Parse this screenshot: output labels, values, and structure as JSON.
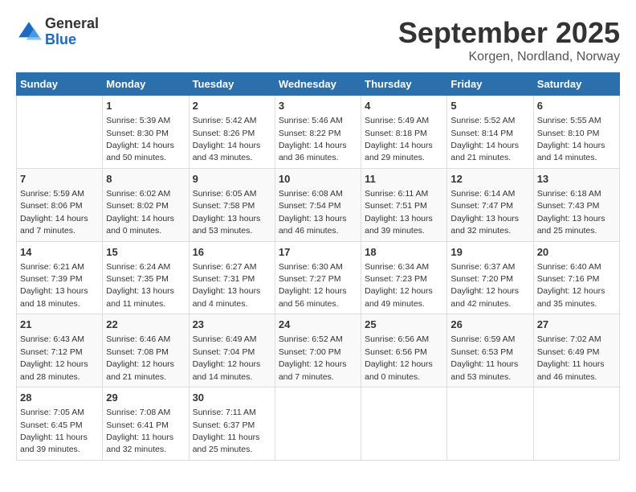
{
  "logo": {
    "general": "General",
    "blue": "Blue"
  },
  "title": "September 2025",
  "location": "Korgen, Nordland, Norway",
  "days_of_week": [
    "Sunday",
    "Monday",
    "Tuesday",
    "Wednesday",
    "Thursday",
    "Friday",
    "Saturday"
  ],
  "weeks": [
    [
      {
        "day": "",
        "info": ""
      },
      {
        "day": "1",
        "info": "Sunrise: 5:39 AM\nSunset: 8:30 PM\nDaylight: 14 hours\nand 50 minutes."
      },
      {
        "day": "2",
        "info": "Sunrise: 5:42 AM\nSunset: 8:26 PM\nDaylight: 14 hours\nand 43 minutes."
      },
      {
        "day": "3",
        "info": "Sunrise: 5:46 AM\nSunset: 8:22 PM\nDaylight: 14 hours\nand 36 minutes."
      },
      {
        "day": "4",
        "info": "Sunrise: 5:49 AM\nSunset: 8:18 PM\nDaylight: 14 hours\nand 29 minutes."
      },
      {
        "day": "5",
        "info": "Sunrise: 5:52 AM\nSunset: 8:14 PM\nDaylight: 14 hours\nand 21 minutes."
      },
      {
        "day": "6",
        "info": "Sunrise: 5:55 AM\nSunset: 8:10 PM\nDaylight: 14 hours\nand 14 minutes."
      }
    ],
    [
      {
        "day": "7",
        "info": "Sunrise: 5:59 AM\nSunset: 8:06 PM\nDaylight: 14 hours\nand 7 minutes."
      },
      {
        "day": "8",
        "info": "Sunrise: 6:02 AM\nSunset: 8:02 PM\nDaylight: 14 hours\nand 0 minutes."
      },
      {
        "day": "9",
        "info": "Sunrise: 6:05 AM\nSunset: 7:58 PM\nDaylight: 13 hours\nand 53 minutes."
      },
      {
        "day": "10",
        "info": "Sunrise: 6:08 AM\nSunset: 7:54 PM\nDaylight: 13 hours\nand 46 minutes."
      },
      {
        "day": "11",
        "info": "Sunrise: 6:11 AM\nSunset: 7:51 PM\nDaylight: 13 hours\nand 39 minutes."
      },
      {
        "day": "12",
        "info": "Sunrise: 6:14 AM\nSunset: 7:47 PM\nDaylight: 13 hours\nand 32 minutes."
      },
      {
        "day": "13",
        "info": "Sunrise: 6:18 AM\nSunset: 7:43 PM\nDaylight: 13 hours\nand 25 minutes."
      }
    ],
    [
      {
        "day": "14",
        "info": "Sunrise: 6:21 AM\nSunset: 7:39 PM\nDaylight: 13 hours\nand 18 minutes."
      },
      {
        "day": "15",
        "info": "Sunrise: 6:24 AM\nSunset: 7:35 PM\nDaylight: 13 hours\nand 11 minutes."
      },
      {
        "day": "16",
        "info": "Sunrise: 6:27 AM\nSunset: 7:31 PM\nDaylight: 13 hours\nand 4 minutes."
      },
      {
        "day": "17",
        "info": "Sunrise: 6:30 AM\nSunset: 7:27 PM\nDaylight: 12 hours\nand 56 minutes."
      },
      {
        "day": "18",
        "info": "Sunrise: 6:34 AM\nSunset: 7:23 PM\nDaylight: 12 hours\nand 49 minutes."
      },
      {
        "day": "19",
        "info": "Sunrise: 6:37 AM\nSunset: 7:20 PM\nDaylight: 12 hours\nand 42 minutes."
      },
      {
        "day": "20",
        "info": "Sunrise: 6:40 AM\nSunset: 7:16 PM\nDaylight: 12 hours\nand 35 minutes."
      }
    ],
    [
      {
        "day": "21",
        "info": "Sunrise: 6:43 AM\nSunset: 7:12 PM\nDaylight: 12 hours\nand 28 minutes."
      },
      {
        "day": "22",
        "info": "Sunrise: 6:46 AM\nSunset: 7:08 PM\nDaylight: 12 hours\nand 21 minutes."
      },
      {
        "day": "23",
        "info": "Sunrise: 6:49 AM\nSunset: 7:04 PM\nDaylight: 12 hours\nand 14 minutes."
      },
      {
        "day": "24",
        "info": "Sunrise: 6:52 AM\nSunset: 7:00 PM\nDaylight: 12 hours\nand 7 minutes."
      },
      {
        "day": "25",
        "info": "Sunrise: 6:56 AM\nSunset: 6:56 PM\nDaylight: 12 hours\nand 0 minutes."
      },
      {
        "day": "26",
        "info": "Sunrise: 6:59 AM\nSunset: 6:53 PM\nDaylight: 11 hours\nand 53 minutes."
      },
      {
        "day": "27",
        "info": "Sunrise: 7:02 AM\nSunset: 6:49 PM\nDaylight: 11 hours\nand 46 minutes."
      }
    ],
    [
      {
        "day": "28",
        "info": "Sunrise: 7:05 AM\nSunset: 6:45 PM\nDaylight: 11 hours\nand 39 minutes."
      },
      {
        "day": "29",
        "info": "Sunrise: 7:08 AM\nSunset: 6:41 PM\nDaylight: 11 hours\nand 32 minutes."
      },
      {
        "day": "30",
        "info": "Sunrise: 7:11 AM\nSunset: 6:37 PM\nDaylight: 11 hours\nand 25 minutes."
      },
      {
        "day": "",
        "info": ""
      },
      {
        "day": "",
        "info": ""
      },
      {
        "day": "",
        "info": ""
      },
      {
        "day": "",
        "info": ""
      }
    ]
  ]
}
